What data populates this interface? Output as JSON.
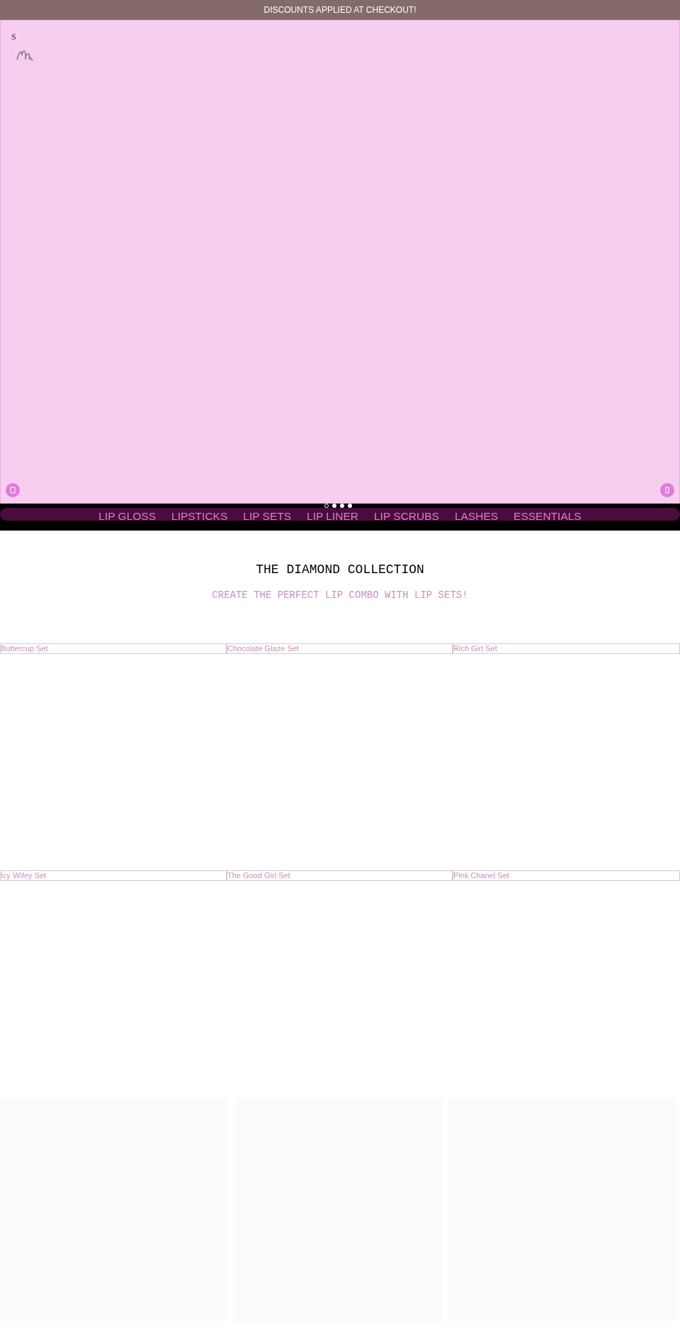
{
  "announcement": "DISCOUNTS APPLIED AT CHECKOUT!",
  "logo_text": "S",
  "slider_dots": [
    {
      "selected": true
    },
    {
      "selected": false
    },
    {
      "selected": false
    },
    {
      "selected": false
    }
  ],
  "nav": [
    "LIP GLOSS",
    "LIPSTICKS",
    "LIP SETS",
    "LIP LINER",
    "LIP SCRUBS",
    "LASHES",
    "ESSENTIALS"
  ],
  "collection": {
    "title": "THE DIAMOND COLLECTION",
    "subtitle": "CREATE THE PERFECT LIP COMBO WITH LIP SETS!"
  },
  "product_rows": [
    [
      "Buttercup Set",
      "Chocolate Glaze Set",
      "Rich Girl Set"
    ],
    [
      "Icy Wifey Set",
      "The Good Girl Set",
      "Pink Chanel Set"
    ]
  ]
}
